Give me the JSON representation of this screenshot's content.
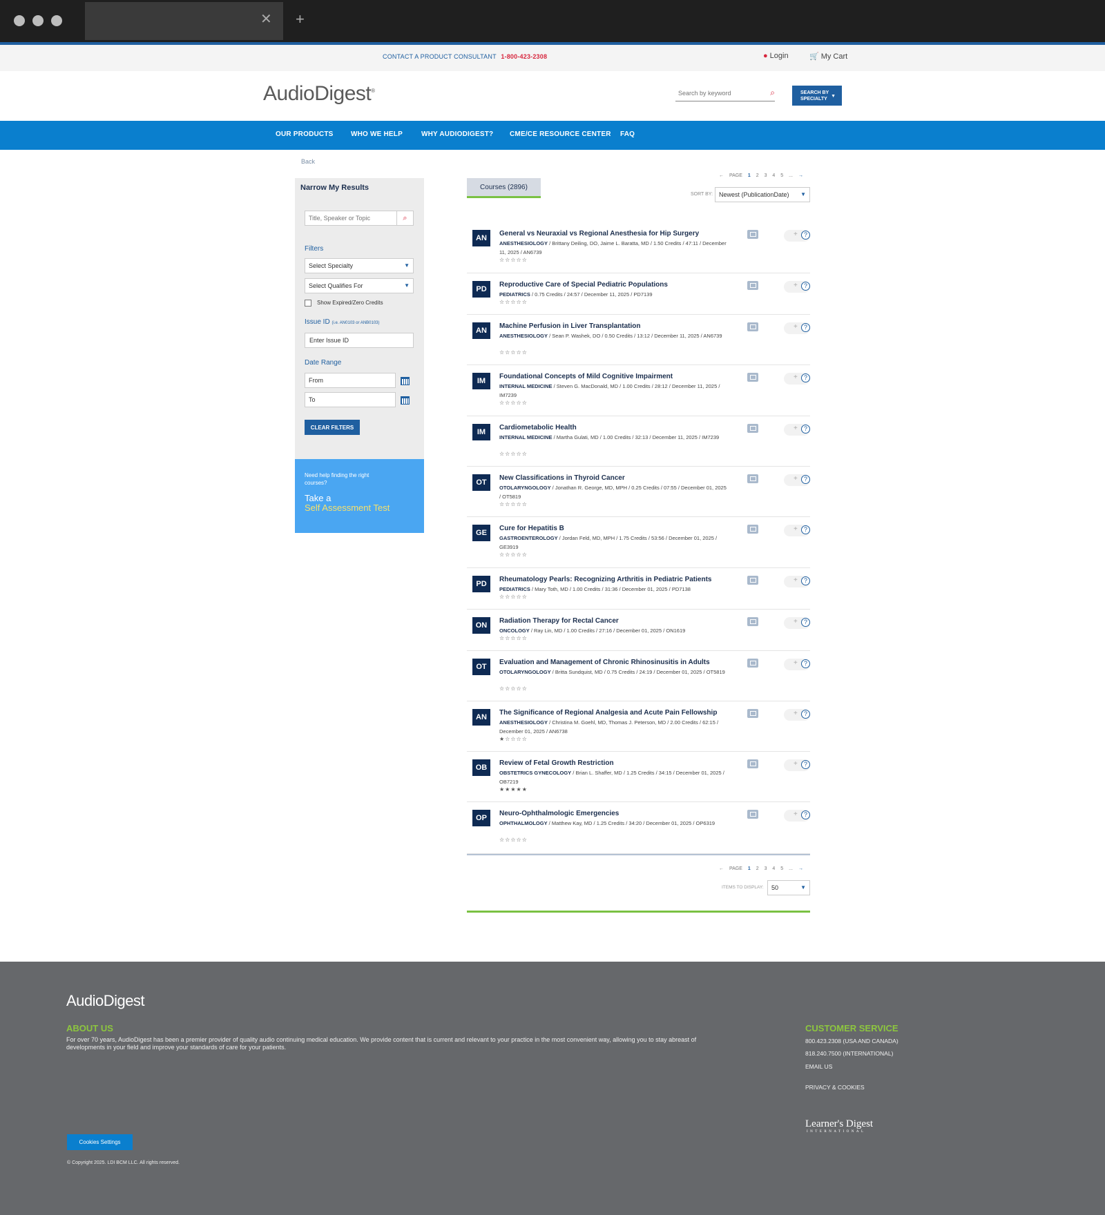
{
  "utility": {
    "consult_label": "CONTACT A PRODUCT CONSULTANT",
    "phone": "1-800-423-2308",
    "login": "Login",
    "cart": "My Cart"
  },
  "header": {
    "logo": "AudioDigest",
    "search_placeholder": "Search by keyword",
    "specialty_button_line1": "SEARCH BY",
    "specialty_button_line2": "SPECIALTY"
  },
  "nav": [
    "OUR PRODUCTS",
    "WHO WE HELP",
    "WHY AUDIODIGEST?",
    "CME/CE RESOURCE CENTER",
    "FAQ"
  ],
  "back": "Back",
  "sidebar": {
    "title": "Narrow My Results",
    "search_placeholder": "Title, Speaker or Topic",
    "filters_label": "Filters",
    "specialty_select": "Select Specialty",
    "qualifies_select": "Select Qualifies For",
    "show_expired": "Show Expired/Zero Credits",
    "issue_label": "Issue ID",
    "issue_hint": "(i.e. AN0103 or ANB0103)",
    "issue_placeholder": "Enter Issue ID",
    "date_label": "Date Range",
    "from": "From",
    "to": "To",
    "clear": "CLEAR FILTERS",
    "promo_small": "Need help finding the right courses?",
    "promo_line1": "Take a",
    "promo_line2": "Self Assessment Test"
  },
  "main": {
    "tab_label": "Courses (2896)",
    "pager": {
      "label": "PAGE",
      "prev": "←",
      "pages": [
        "1",
        "2",
        "3",
        "4",
        "5",
        "..."
      ],
      "next": "→"
    },
    "sort_label": "SORT BY:",
    "sort_value": "Newest (PublicationDate)",
    "items_label": "ITEMS TO DISPLAY:",
    "items_value": "50"
  },
  "courses": [
    {
      "badge": "AN",
      "title": "General vs Neuraxial vs Regional Anesthesia for Hip Surgery",
      "specialty": "ANESTHESIOLOGY",
      "meta": " / Brittany Deiling, DO, Jaime L. Baratta, MD / 1.50 Credits / 47:11 / December 11, 2025 / AN6739",
      "rating": 0
    },
    {
      "badge": "PD",
      "title": "Reproductive Care of Special Pediatric Populations",
      "specialty": "PEDIATRICS",
      "meta": " / 0.75 Credits / 24:57 / December 11, 2025 / PD7139",
      "rating": 0
    },
    {
      "badge": "AN",
      "title": "Machine Perfusion in Liver Transplantation",
      "specialty": "ANESTHESIOLOGY",
      "meta": " / Sean P. Washek, DO / 0.50 Credits / 13:12 / December 11, 2025 / AN6739",
      "rating": 0
    },
    {
      "badge": "IM",
      "title": "Foundational Concepts of Mild Cognitive Impairment",
      "specialty": "INTERNAL MEDICINE",
      "meta": " / Steven G. MacDonald, MD / 1.00 Credits / 28:12 / December 11, 2025 / IM7239",
      "rating": 0
    },
    {
      "badge": "IM",
      "title": "Cardiometabolic Health",
      "specialty": "INTERNAL MEDICINE",
      "meta": " / Martha Gulati, MD / 1.00 Credits / 32:13 / December 11, 2025 / IM7239",
      "rating": 0
    },
    {
      "badge": "OT",
      "title": "New Classifications in Thyroid Cancer",
      "specialty": "OTOLARYNGOLOGY",
      "meta": " / Jonathan R. George, MD, MPH / 0.25 Credits / 07:55 / December 01, 2025 / OT5819",
      "rating": 0
    },
    {
      "badge": "GE",
      "title": "Cure for Hepatitis B",
      "specialty": "GASTROENTEROLOGY",
      "meta": " / Jordan Feld, MD, MPH / 1.75 Credits / 53:56 / December 01, 2025 / GE3919",
      "rating": 0
    },
    {
      "badge": "PD",
      "title": "Rheumatology Pearls: Recognizing Arthritis in Pediatric Patients",
      "specialty": "PEDIATRICS",
      "meta": " / Mary Toth, MD / 1.00 Credits / 31:36 / December 01, 2025 / PD7138",
      "rating": 0
    },
    {
      "badge": "ON",
      "title": "Radiation Therapy for Rectal Cancer",
      "specialty": "ONCOLOGY",
      "meta": " / Ray Lin, MD / 1.00 Credits / 27:16 / December 01, 2025 / ON1619",
      "rating": 0
    },
    {
      "badge": "OT",
      "title": "Evaluation and Management of Chronic Rhinosinusitis in Adults",
      "specialty": "OTOLARYNGOLOGY",
      "meta": " / Britta Sundquist, MD / 0.75 Credits / 24:19 / December 01, 2025 / OT5819",
      "rating": 0
    },
    {
      "badge": "AN",
      "title": "The Significance of Regional Analgesia and Acute Pain Fellowship",
      "specialty": "ANESTHESIOLOGY",
      "meta": " / Christina M. Goehl, MD, Thomas J. Peterson, MD / 2.00 Credits / 62:15 / December 01, 2025 / AN6738",
      "rating": 1
    },
    {
      "badge": "OB",
      "title": "Review of Fetal Growth Restriction",
      "specialty": "OBSTETRICS GYNECOLOGY",
      "meta": " / Brian L. Shaffer, MD / 1.25 Credits / 34:15 / December 01, 2025 / OB7219",
      "rating": 5
    },
    {
      "badge": "OP",
      "title": "Neuro-Ophthalmologic Emergencies",
      "specialty": "OPHTHALMOLOGY",
      "meta": " / Matthew Kay, MD / 1.25 Credits / 34:20 / December 01, 2025 / OP6319",
      "rating": 0
    }
  ],
  "footer": {
    "logo": "AudioDigest",
    "about_title": "ABOUT US",
    "about_text": "For over 70 years, AudioDigest has been a premier provider of quality audio continuing medical education. We provide content that is current and relevant to your practice in the most convenient way, allowing you to stay abreast of developments in your field and improve your standards of care for your patients.",
    "cs_title": "CUSTOMER SERVICE",
    "cs_phone1": "800.423.2308 (USA AND CANADA)",
    "cs_phone2": "818.240.7500 (INTERNATIONAL)",
    "cs_email": "EMAIL US",
    "privacy": "PRIVACY & COOKIES",
    "ldi_name": "Learner's Digest",
    "ldi_sub": "INTERNATIONAL",
    "cookies_button": "Cookies Settings",
    "copyright": "© Copyright 2025. LDI BCM LLC. All rights reserved."
  }
}
